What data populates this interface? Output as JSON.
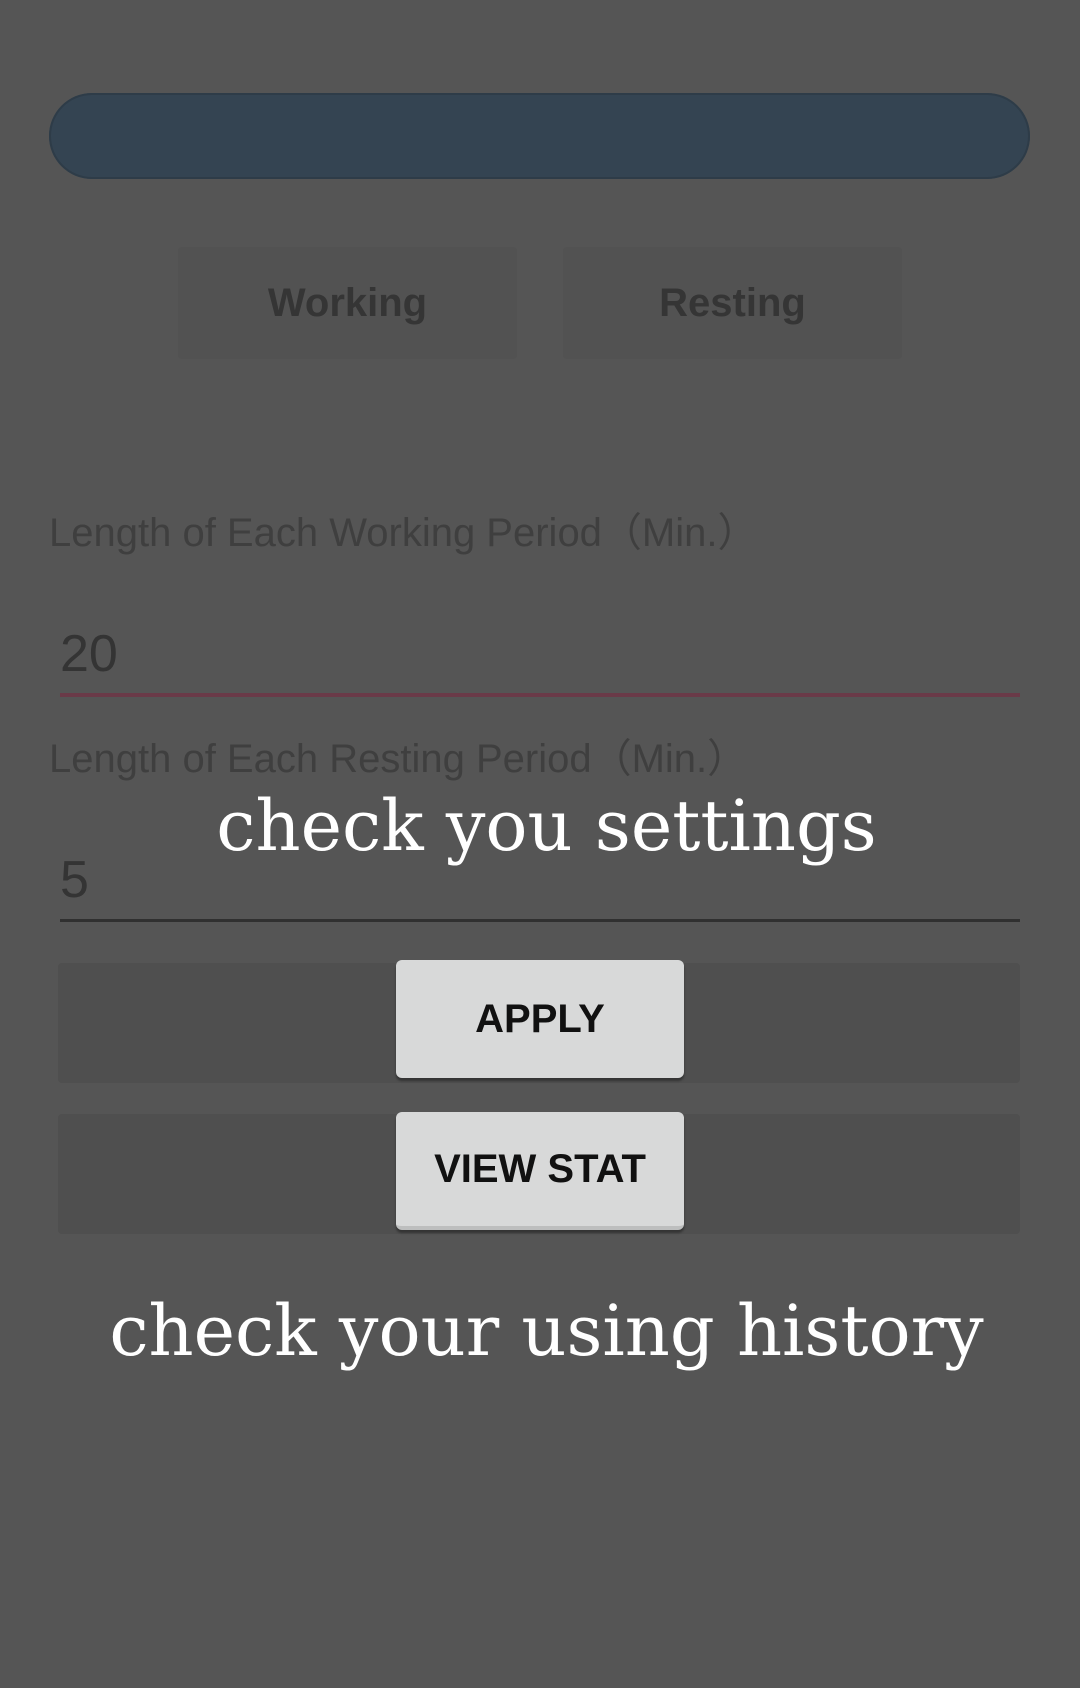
{
  "mode_buttons": {
    "working_label": "Working",
    "resting_label": "Resting"
  },
  "settings": {
    "working_period_label": "Length of Each Working Period（Min.）",
    "working_period_value": "20",
    "resting_period_label": "Length of Each Resting Period（Min.）",
    "resting_period_value": "5"
  },
  "actions": {
    "apply_label": "APPLY",
    "view_stat_label": "VIEW STAT"
  },
  "coach_marks": {
    "settings_hint": "check you settings",
    "history_hint": "check your using history"
  },
  "colors": {
    "overlay": "#555555",
    "progress_bar": "#344452",
    "active_underline": "#6a3a48",
    "highlight_button": "#d8d9d9"
  }
}
